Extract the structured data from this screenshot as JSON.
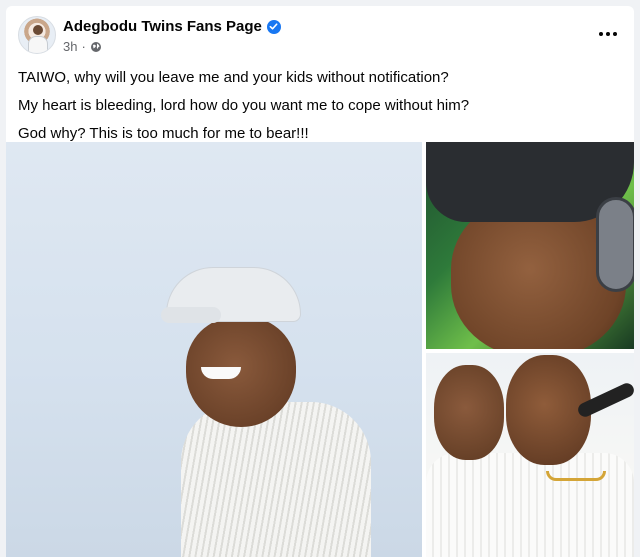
{
  "post": {
    "page_name": "Adegbodu Twins Fans Page",
    "time": "3h",
    "separator": "·",
    "verified_icon": "verified-check-icon",
    "audience_icon": "globe-icon",
    "more_icon": "more-options-icon",
    "lines": [
      "TAIWO, why will you leave me and your kids without notification?",
      "My heart is bleeding, lord how do you want me to cope without him?",
      "God why? This is too much for me to bear!!!"
    ]
  },
  "colors": {
    "accent": "#1877f2",
    "text": "#050505",
    "secondary_text": "#65676b",
    "background": "#f0f2f5",
    "card": "#ffffff"
  },
  "photos": [
    {
      "name": "photo-man-white-cap-smiling"
    },
    {
      "name": "photo-man-cap-headphones"
    },
    {
      "name": "photo-men-singing-microphone"
    }
  ]
}
